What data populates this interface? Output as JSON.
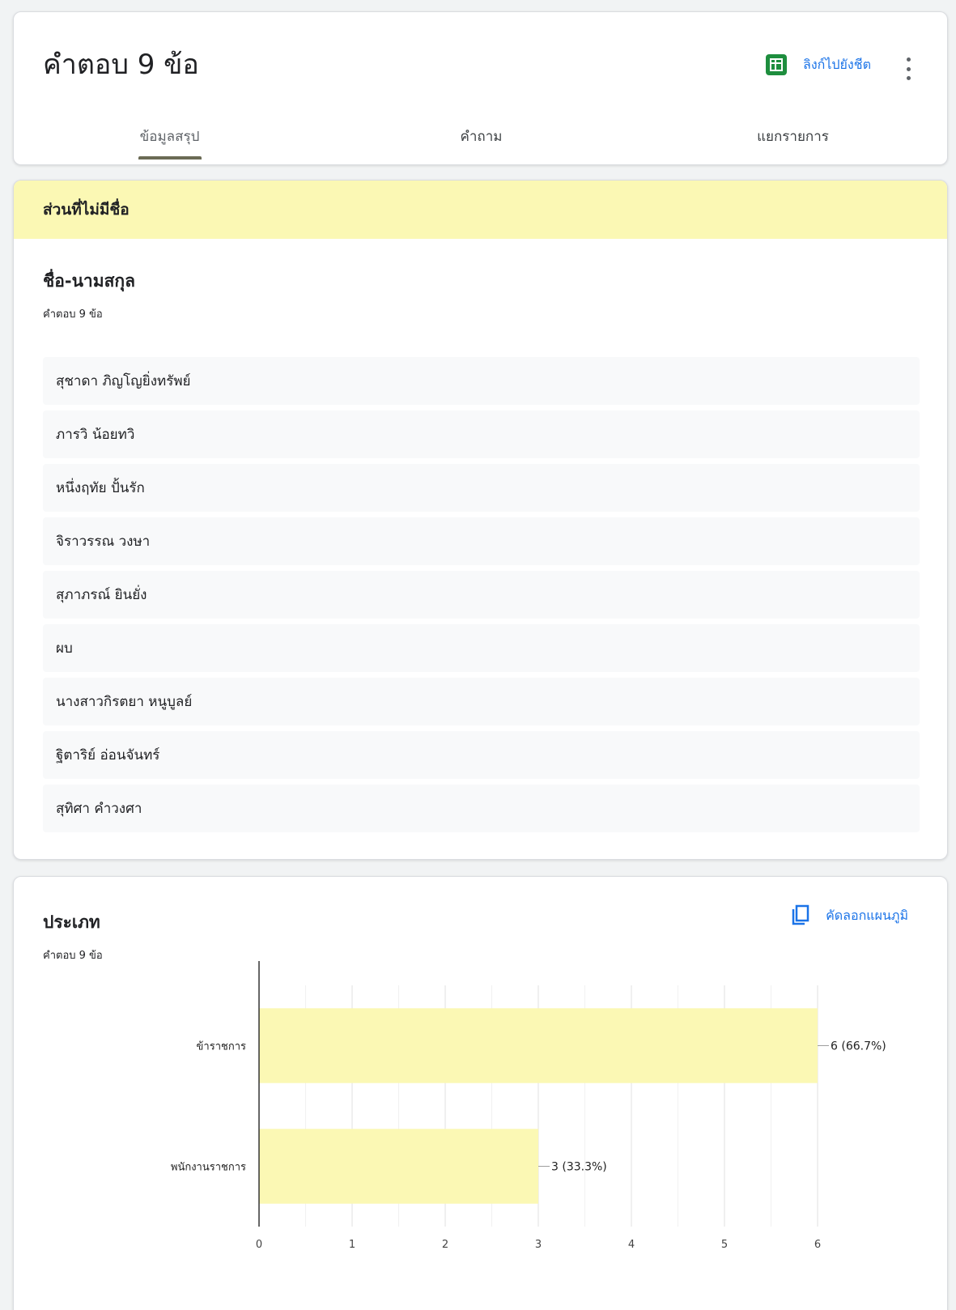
{
  "header": {
    "title": "คำตอบ 9 ข้อ",
    "sheets_link": "ลิงก์ไปยังชีต",
    "tabs": [
      {
        "label": "ข้อมูลสรุป",
        "active": true
      },
      {
        "label": "คำถาม",
        "active": false
      },
      {
        "label": "แยกรายการ",
        "active": false
      }
    ]
  },
  "section": {
    "banner": "ส่วนที่ไม่มีชื่อ",
    "question": "ชื่อ-นามสกุล",
    "count": "คำตอบ 9 ข้อ",
    "answers": [
      "สุชาดา ภิญโญยิ่งทรัพย์",
      "ภารวิ น้อยทวิ",
      "หนึ่งฤทัย ปั้นรัก",
      "จิราวรรณ วงษา",
      "สุภาภรณ์ ยินยั่ง",
      "ผบ",
      "นางสาวกิรตยา หนูบูลย์",
      "ฐิตาริย์ อ่อนจันทร์",
      "สุทิศา คำวงศา"
    ]
  },
  "chart_card": {
    "title": "ประเภท",
    "count": "คำตอบ 9 ข้อ",
    "copy_label": "คัดลอกแผนภูมิ"
  },
  "colors": {
    "bar_fill": "#fbf8b4",
    "banner_fill": "#fbf8b4",
    "link_blue": "#1a73e8",
    "sheets_green": "#1e8e3e"
  },
  "chart_data": {
    "type": "bar",
    "orientation": "horizontal",
    "categories": [
      "ข้าราชการ",
      "พนักงานราชการ"
    ],
    "values": [
      6,
      3
    ],
    "data_labels": [
      "6 (66.7%)",
      "3 (33.3%)"
    ],
    "xlim": [
      0,
      6
    ],
    "x_ticks": [
      "0",
      "1",
      "2",
      "3",
      "4",
      "5",
      "6"
    ],
    "grid": true
  }
}
